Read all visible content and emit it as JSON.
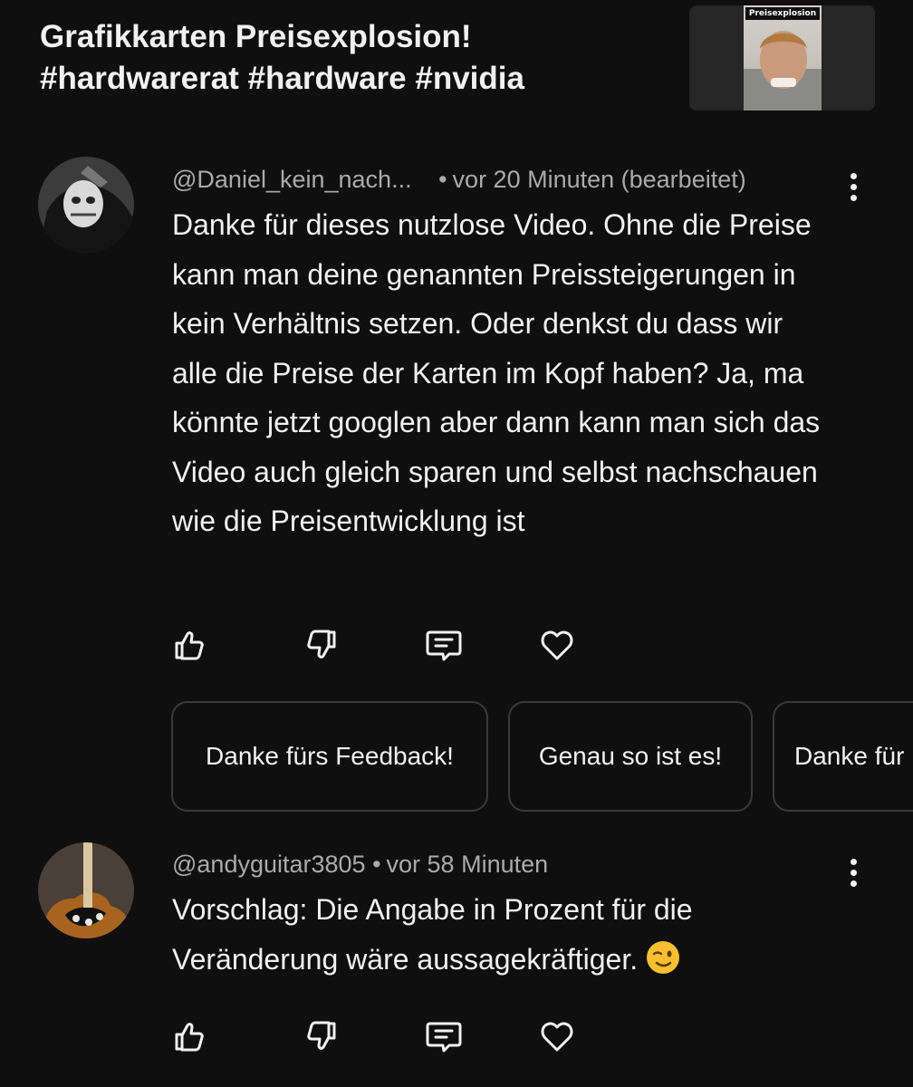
{
  "video": {
    "title_line1": "Grafikkarten Preisexplosion!",
    "title_line2": "#hardwarerat #hardware #nvidia",
    "thumbnail_caption": "Preisexplosion"
  },
  "comments": [
    {
      "author": "@Daniel_kein_nach...",
      "time": "vor 20 Minuten (bearbeitet)",
      "text": "Danke für dieses nutzlose Video. Ohne die Preise kann man deine genannten Preissteigerungen in kein Verhältnis setzen. Oder denkst du dass wir alle die Preise der Karten im Kopf haben? Ja, ma könnte jetzt googlen aber dann kann man sich das Video auch gleich sparen und selbst nachschauen wie die Preisentwicklung ist",
      "avatar_icon": "masked-face-avatar"
    },
    {
      "author": "@andyguitar3805",
      "time": "vor 58 Minuten",
      "text": "Vorschlag: Die Angabe in Prozent für die Veränderung wäre aussagekräftiger.",
      "emoji": "winking-face-emoji",
      "avatar_icon": "guitar-avatar"
    }
  ],
  "suggested_replies": [
    "Danke fürs Feedback!",
    "Genau so ist es!",
    "Danke für"
  ],
  "icons": {
    "like": "thumbs-up-icon",
    "dislike": "thumbs-down-icon",
    "reply": "reply-icon",
    "heart": "heart-icon",
    "more": "more-vertical-icon"
  },
  "colors": {
    "background": "#0f0f0f",
    "text": "#f1f1f1",
    "secondary_text": "#aaaaaa",
    "chip_border": "#3a3a3a"
  }
}
